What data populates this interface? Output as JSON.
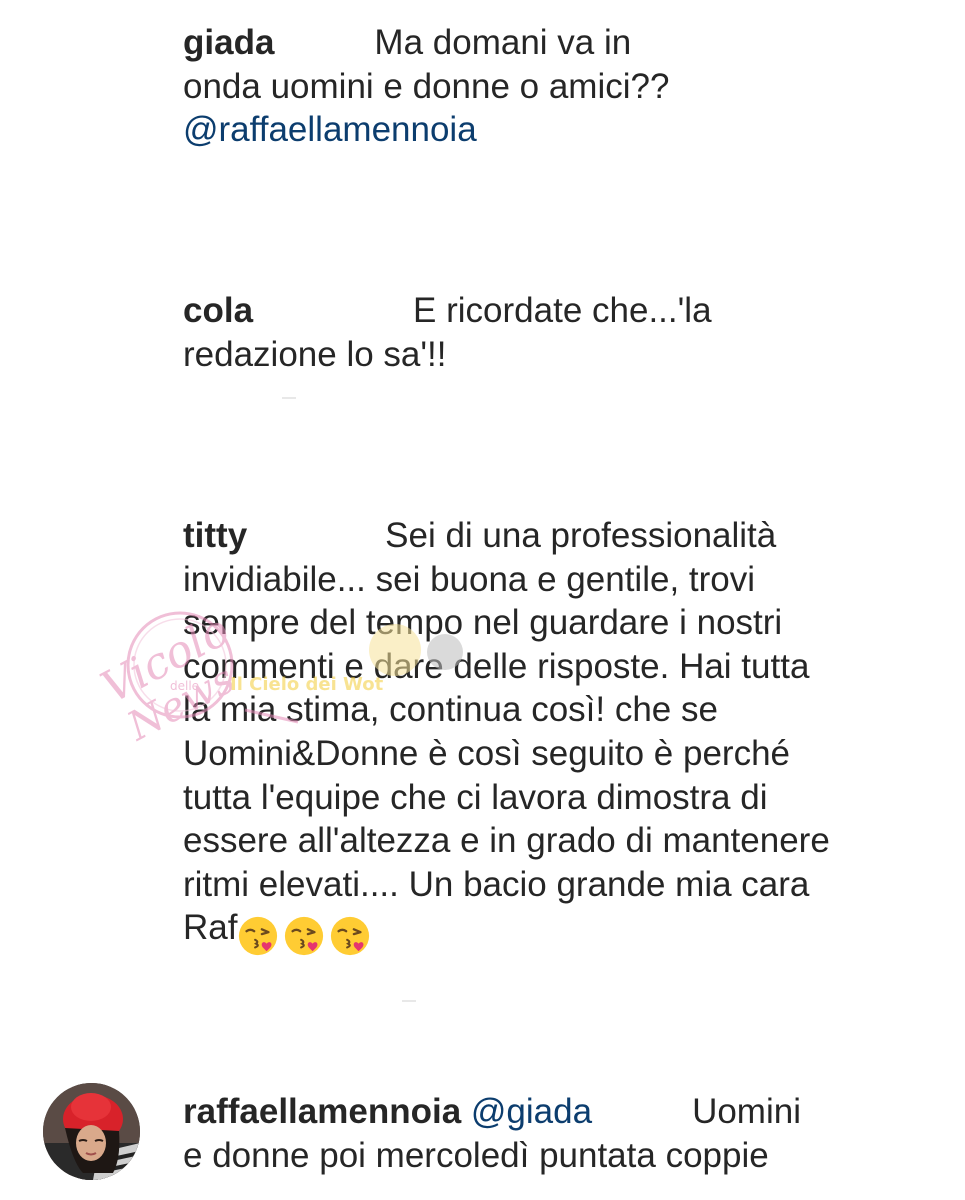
{
  "comments": [
    {
      "username": "giada",
      "text_line1": "Ma domani va in",
      "text_rest": "onda uomini e donne o amici??",
      "mention": "@raffaellamennoia"
    },
    {
      "username": "cola",
      "text_line1": "E ricordate che...'la",
      "text_rest": "redazione lo sa'!!"
    },
    {
      "username": "titty",
      "text_line1": "Sei di una professionalità",
      "text_rest": "invidiabile... sei buona e gentile, trovi sempre del tempo nel guardare i nostri commenti e dare delle risposte. Hai tutta la mia stima, continua così! che se Uomini&Donne è così seguito è perché tutta l'equipe che ci lavora dimostra di essere all'altezza e in grado di mantenere ritmi elevati.... Un bacio grande mia cara Raf",
      "emojis": [
        "face-blowing-kiss",
        "face-blowing-kiss",
        "face-blowing-kiss"
      ]
    },
    {
      "username": "raffaellamennoia",
      "mention": "@giada",
      "text_line1": "Uomini",
      "text_rest": "e donne poi mercoledì puntata coppie"
    }
  ],
  "watermark": {
    "brand_line1": "Vicolo",
    "brand_line2": "delle",
    "brand_line3": "News",
    "tagline": "Il Cielo dei Wot"
  },
  "colors": {
    "text": "#262626",
    "mention": "#0c3d6e",
    "watermark": "#e58bb8"
  }
}
